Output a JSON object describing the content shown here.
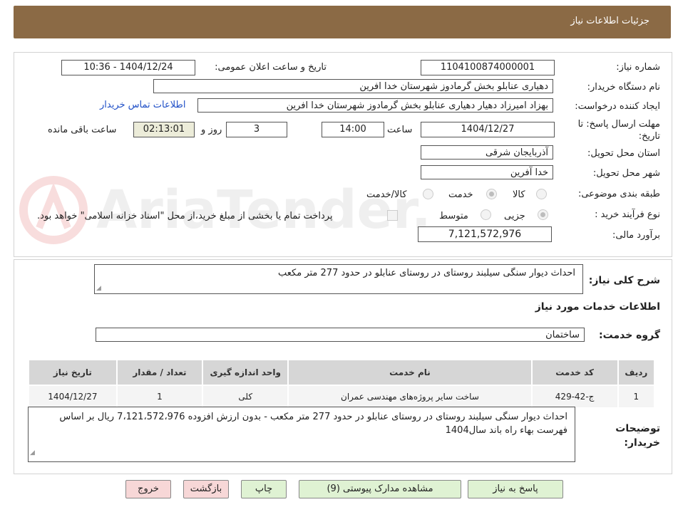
{
  "header": {
    "title": "جزئیات اطلاعات نیاز"
  },
  "form": {
    "need_number_label": "شماره نیاز:",
    "need_number": "1104100874000001",
    "announce_label": "تاریخ و ساعت اعلان عمومی:",
    "announce_value": "1404/12/24 - 10:36",
    "buyer_org_label": "نام دستگاه خریدار:",
    "buyer_org": "دهیاری عنابلو بخش گرمادوز شهرستان خدا افرین",
    "requester_label": "ایجاد کننده درخواست:",
    "requester": "بهزاد امیرزاد دهیار دهیاری عنابلو بخش گرمادوز شهرستان خدا افرین",
    "contact_link": "اطلاعات تماس خریدار",
    "deadline_label": "مهلت ارسال پاسخ: تا تاریخ:",
    "deadline_date": "1404/12/27",
    "time_label": "ساعت",
    "deadline_time": "14:00",
    "days_value": "3",
    "days_label": "روز و",
    "remaining_time": "02:13:01",
    "remaining_label": "ساعت باقی مانده",
    "province_label": "استان محل تحویل:",
    "province": "آذربایجان شرقی",
    "city_label": "شهر محل تحویل:",
    "city": "خدا آفرین",
    "category_label": "طبقه بندی موضوعی:",
    "category_options": [
      "کالا",
      "خدمت",
      "کالا/خدمت"
    ],
    "process_label": "نوع فرآیند خرید :",
    "process_options": [
      "جزیی",
      "متوسط"
    ],
    "payment_note": "پرداخت تمام یا بخشی از مبلغ خرید،از محل \"اسناد خزانه اسلامی\" خواهد بود.",
    "budget_label": "برآورد مالی:",
    "budget": "7,121,572,976"
  },
  "summary": {
    "label": "شرح کلی نیاز:",
    "text": "احداث دیوار سنگی سیلبند روستای در روستای عنابلو در حدود  277 متر مکعب"
  },
  "services": {
    "section_title": "اطلاعات خدمات مورد نیاز",
    "group_label": "گروه خدمت:",
    "group_value": "ساختمان",
    "columns": [
      "ردیف",
      "کد خدمت",
      "نام خدمت",
      "واحد اندازه گیری",
      "تعداد / مقدار",
      "تاریخ نیاز"
    ],
    "rows": [
      {
        "row": "1",
        "code": "ج-42-429",
        "name": "ساخت سایر پروژه‌های مهندسی عمران",
        "unit": "کلی",
        "qty": "1",
        "date": "1404/12/27"
      }
    ]
  },
  "notes": {
    "label": "توضیحات خریدار:",
    "text": "احداث دیوار سنگی سیلبند روستای در روستای عنابلو در حدود  277 متر مکعب -  بدون ارزش افزوده 7،121،572،976 ریال بر اساس فهرست بهاء راه باند سال1404"
  },
  "buttons": {
    "reply": "پاسخ به نیاز",
    "docs": "مشاهده مدارک پیوستی (9)",
    "print": "چاپ",
    "back": "بازگشت",
    "exit": "خروج"
  },
  "watermark": {
    "text": "AriaTender.net"
  }
}
